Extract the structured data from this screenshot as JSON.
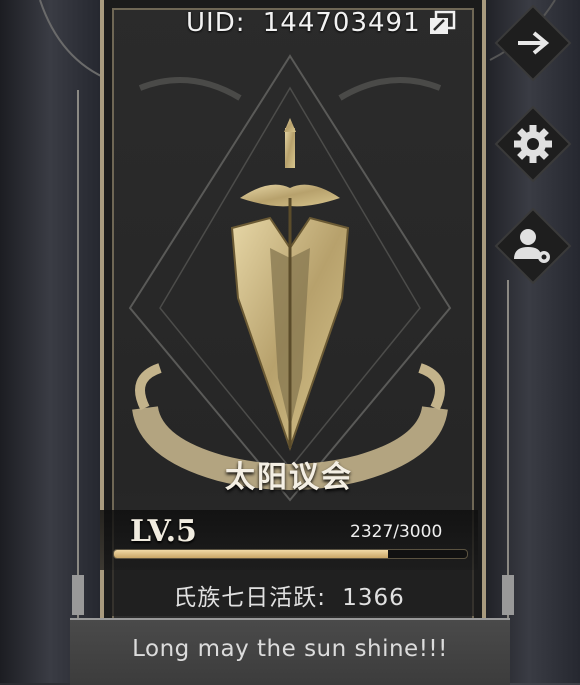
{
  "profile": {
    "uid_label": "UID:",
    "uid_value": "144703491"
  },
  "clan": {
    "name": "太阳议会",
    "level": "LV.5",
    "xp_text": "2327/3000",
    "xp_progress": 0.7757,
    "activity_label": "氏族七日活跃:",
    "activity_value": "1366",
    "motto": "Long may the sun shine!!!"
  },
  "side_buttons": [
    {
      "name": "exit-arrow-icon"
    },
    {
      "name": "gear-icon"
    },
    {
      "name": "user-settings-icon"
    }
  ],
  "colors": {
    "gold": "#c9b27a",
    "xp_bar_fill": "#e9cf98",
    "banner_bg": "#272727",
    "button_bg": "#1e1e1e"
  }
}
